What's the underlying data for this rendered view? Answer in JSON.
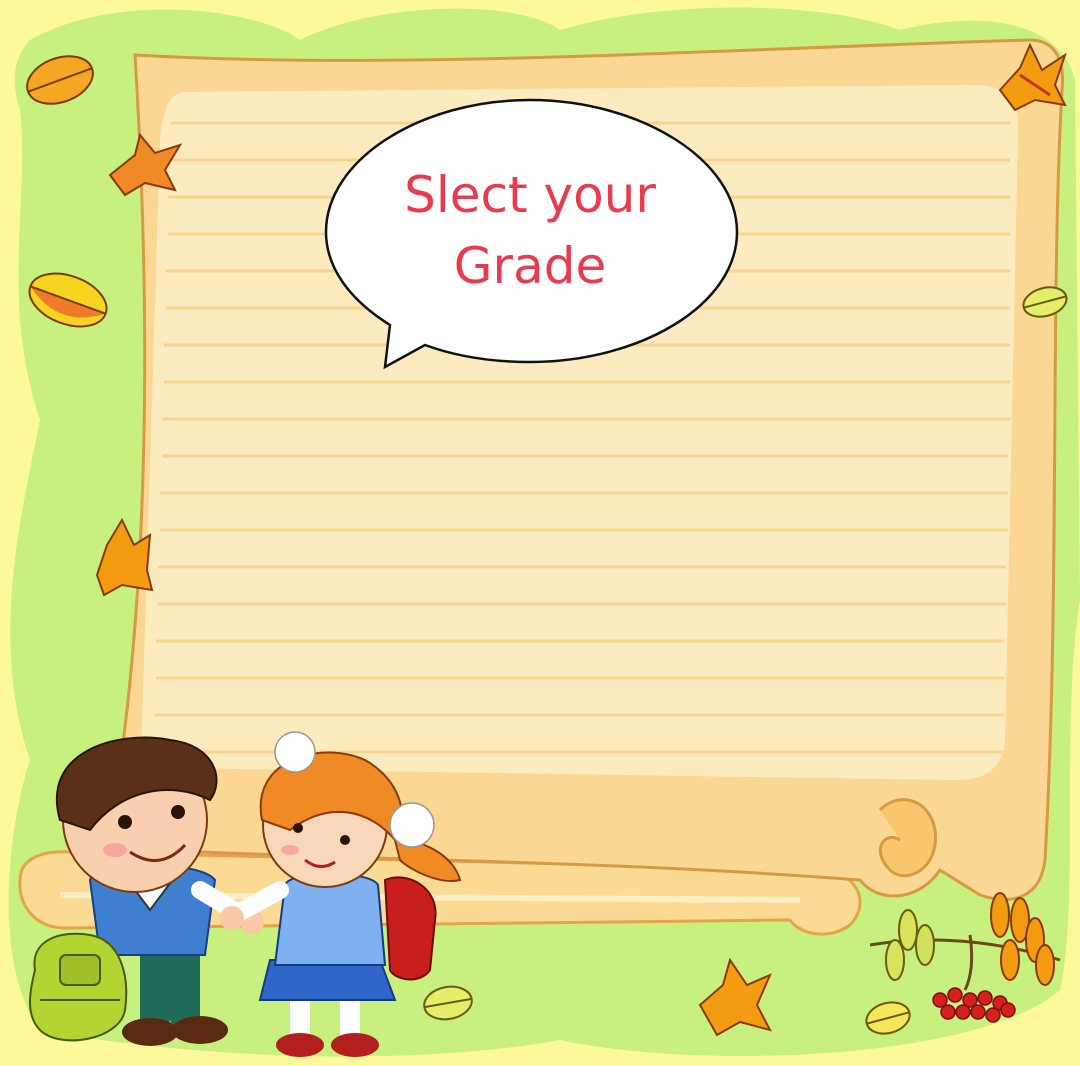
{
  "prompt": {
    "line1": "Slect your",
    "line2": "Grade"
  },
  "colors": {
    "background": "#fdf89a",
    "green_blob": "#c8f07e",
    "paper": "#fbe7b2",
    "paper_lines": "#f7d896",
    "paper_border": "#e9b86a",
    "prompt_text": "#ea3b4e",
    "bubble_fill": "#ffffff",
    "bubble_stroke": "#111111"
  },
  "icons": [
    "autumn-leaf-icon",
    "rowan-berry-branch-icon",
    "school-boy-illustration",
    "school-girl-illustration",
    "backpack-icon"
  ]
}
